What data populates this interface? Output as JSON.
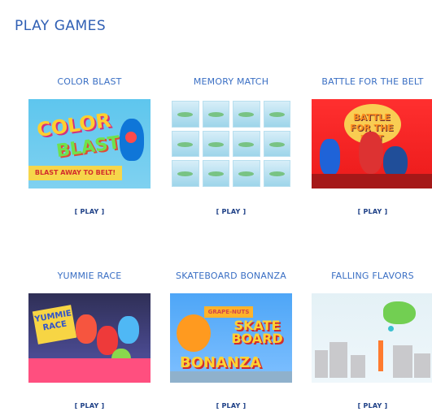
{
  "page": {
    "title": "PLAY GAMES"
  },
  "games": [
    {
      "title": "COLOR BLAST",
      "play_label": "[ PLAY ]",
      "thumb_text_1": "COLOR",
      "thumb_text_2": "BLAST!",
      "thumb_strip": "BLAST AWAY TO BELT!"
    },
    {
      "title": "MEMORY MATCH",
      "play_label": "[ PLAY ]"
    },
    {
      "title": "BATTLE FOR THE BELT",
      "play_label": "[ PLAY ]",
      "thumb_text_1": "BATTLE FOR THE BELT"
    },
    {
      "title": "YUMMIE RACE",
      "play_label": "[ PLAY ]",
      "thumb_text_1": "YUMMIE RACE"
    },
    {
      "title": "SKATEBOARD BONANZA",
      "play_label": "[ PLAY ]",
      "thumb_text_1": "GRAPE-NUTS",
      "thumb_text_2": "SKATE BOARD",
      "thumb_text_3": "BONANZA"
    },
    {
      "title": "FALLING FLAVORS",
      "play_label": "[ PLAY ]"
    }
  ]
}
